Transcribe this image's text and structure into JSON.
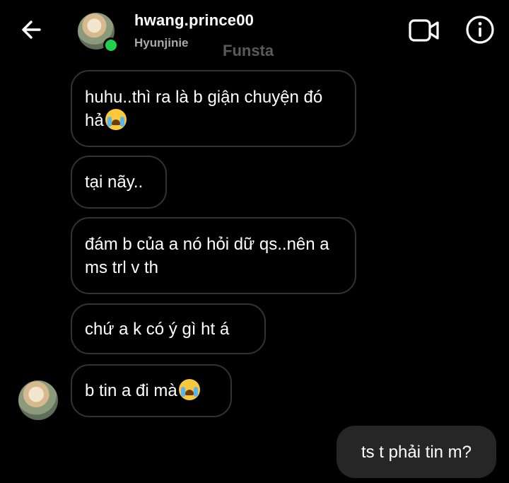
{
  "header": {
    "username": "hwang.prince00",
    "subname": "Hyunjinie",
    "watermark": "Funsta",
    "back_icon": "arrow-left-icon",
    "video_icon": "video-call-icon",
    "info_icon": "info-icon",
    "online_color": "#1fd14c"
  },
  "messages": [
    {
      "text": "huhu..thì ra là b giận chuyện đó hả",
      "emoji": "loudly-crying-emoji",
      "sender": "them"
    },
    {
      "text": "tại nãy..",
      "sender": "them"
    },
    {
      "text": "đám b của a nó hỏi dữ qs..nên a ms trl v th",
      "sender": "them"
    },
    {
      "text": "chứ a k có ý gì ht á",
      "sender": "them"
    },
    {
      "text": "b tin a đi mà",
      "emoji": "loudly-crying-emoji",
      "sender": "them"
    },
    {
      "text": "ts t phải tin m?",
      "sender": "me"
    }
  ],
  "colors": {
    "background": "#000000",
    "incoming_border": "#333333",
    "outgoing_bg": "#262626",
    "secondary_text": "#a8a8a8"
  }
}
